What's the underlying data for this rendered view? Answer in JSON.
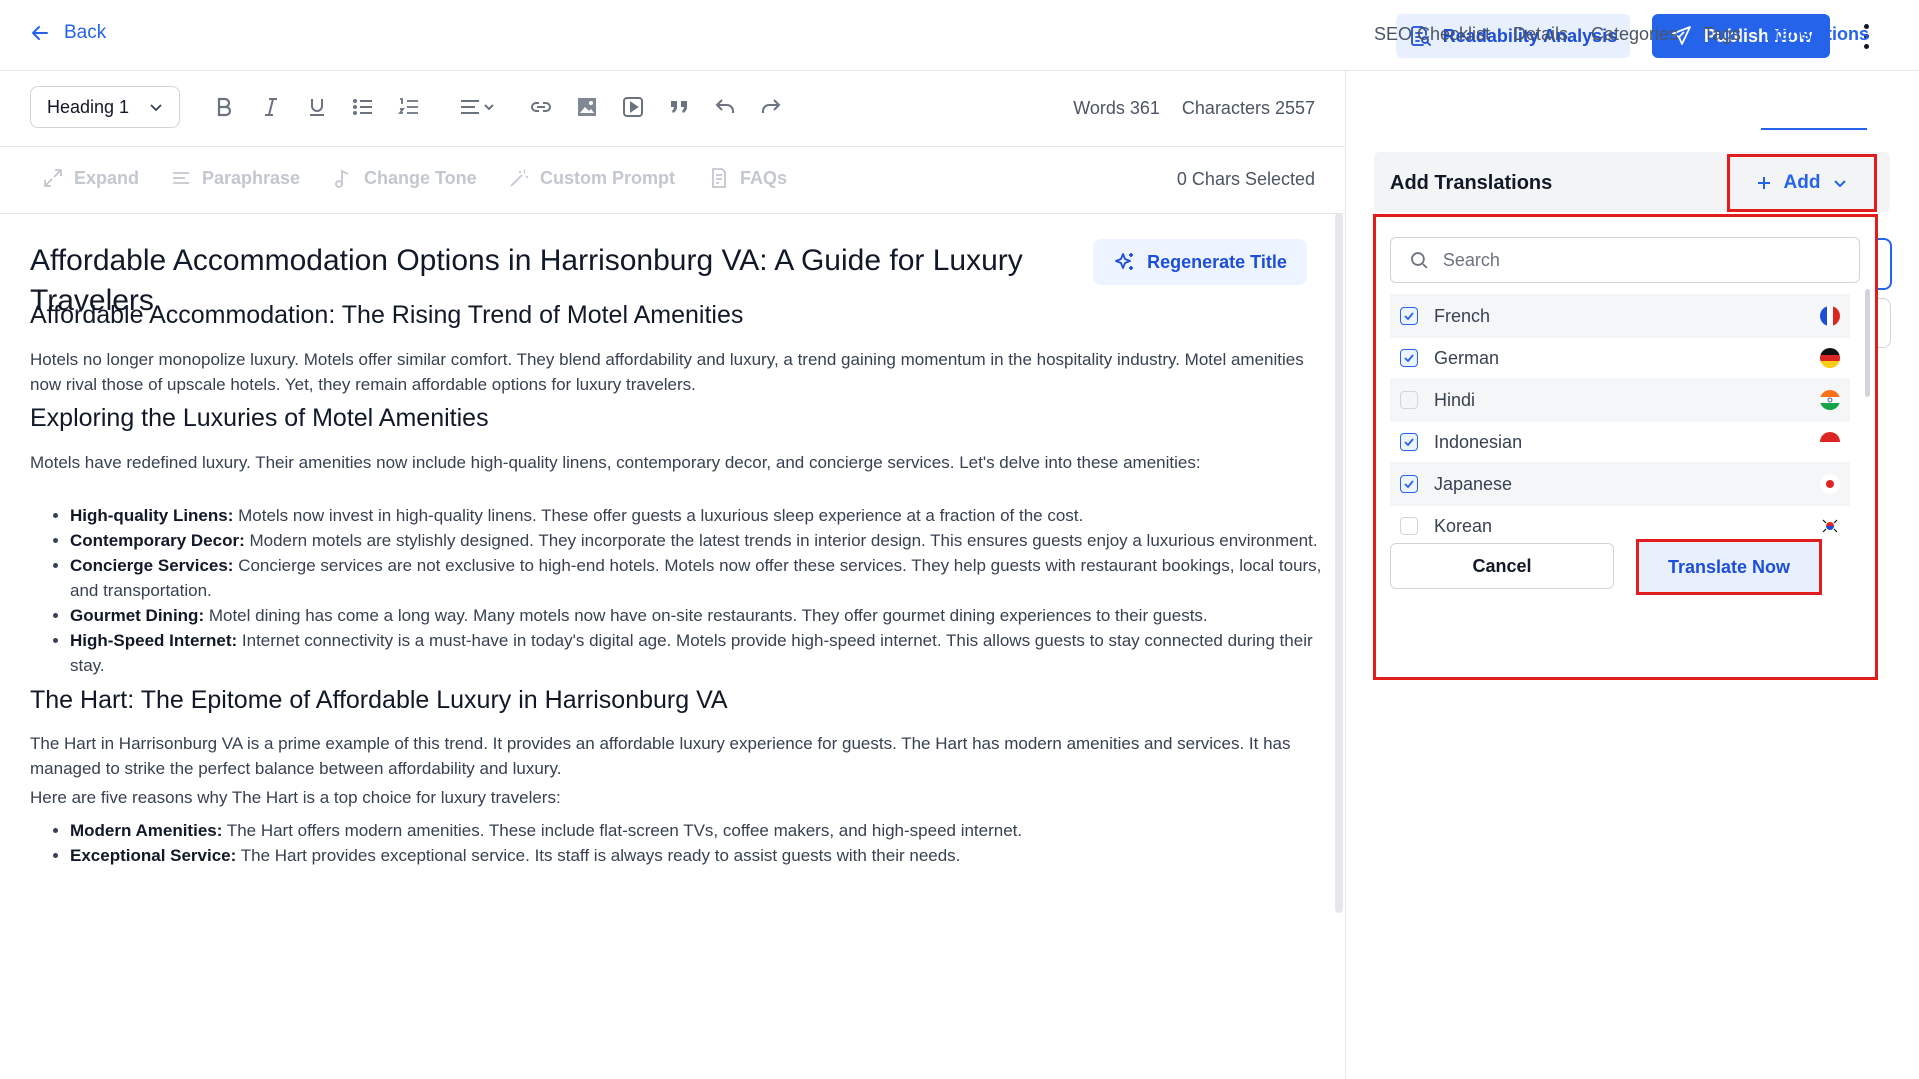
{
  "header": {
    "back_label": "Back",
    "readability_label": "Readability Analysis",
    "publish_label": "Publish Now"
  },
  "toolbar": {
    "heading_value": "Heading 1",
    "words_label": "Words 361",
    "characters_label": "Characters 2557",
    "tools": [
      "bold-icon",
      "italic-icon",
      "underline-icon",
      "bullet-list-icon",
      "numbered-list-icon",
      "align-icon",
      "link-icon",
      "image-icon",
      "video-icon",
      "quote-icon",
      "undo-icon",
      "redo-icon"
    ]
  },
  "ai_tools": {
    "expand": "Expand",
    "paraphrase": "Paraphrase",
    "change_tone": "Change Tone",
    "custom_prompt": "Custom Prompt",
    "faqs": "FAQs",
    "chars_selected": "0 Chars Selected"
  },
  "article": {
    "title": "Affordable Accommodation Options in Harrisonburg VA: A Guide for Luxury Travelers",
    "regenerate_label": "Regenerate Title",
    "h2_1": "Affordable Accommodation: The Rising Trend of Motel Amenities",
    "p1": "Hotels no longer monopolize luxury. Motels offer similar comfort. They blend affordability and luxury, a trend gaining momentum in the hospitality industry. Motel amenities now rival those of upscale hotels. Yet, they remain affordable options for luxury travelers.",
    "h2_2": "Exploring the Luxuries of Motel Amenities",
    "p2": "Motels have redefined luxury. Their amenities now include high-quality linens, contemporary decor, and concierge services. Let's delve into these amenities:",
    "list1": [
      {
        "term": "High-quality Linens:",
        "text": " Motels now invest in high-quality linens. These offer guests a luxurious sleep experience at a fraction of the cost."
      },
      {
        "term": "Contemporary Decor:",
        "text": " Modern motels are stylishly designed. They incorporate the latest trends in interior design. This ensures guests enjoy a luxurious environment."
      },
      {
        "term": "Concierge Services:",
        "text": " Concierge services are not exclusive to high-end hotels. Motels now offer these services. They help guests with restaurant bookings, local tours, and transportation."
      },
      {
        "term": "Gourmet Dining:",
        "text": " Motel dining has come a long way. Many motels now have on-site restaurants. They offer gourmet dining experiences to their guests."
      },
      {
        "term": "High-Speed Internet:",
        "text": " Internet connectivity is a must-have in today's digital age. Motels provide high-speed internet. This allows guests to stay connected during their stay."
      }
    ],
    "h2_3": "The Hart: The Epitome of Affordable Luxury in Harrisonburg VA",
    "p3": "The Hart in Harrisonburg VA is a prime example of this trend. It provides an affordable luxury experience for guests. The Hart has modern amenities and services. It has managed to strike the perfect balance between affordability and luxury.",
    "p4": "Here are five reasons why The Hart is a top choice for luxury travelers:",
    "list2": [
      {
        "term": "Modern Amenities:",
        "text": " The Hart offers modern amenities. These include flat-screen TVs, coffee makers, and high-speed internet."
      },
      {
        "term": "Exceptional Service:",
        "text": " The Hart provides exceptional service. Its staff is always ready to assist guests with their needs."
      }
    ]
  },
  "sidebar": {
    "tabs": [
      "SEO Checklist",
      "Details",
      "Categories",
      "Tags",
      "Translations"
    ],
    "active_tab": "Translations",
    "panel_title": "Add Translations",
    "add_label": "Add",
    "search_placeholder": "Search",
    "languages": [
      {
        "label": "French",
        "checked": true,
        "flag": "flag-france-icon"
      },
      {
        "label": "German",
        "checked": true,
        "flag": "flag-germany-icon"
      },
      {
        "label": "Hindi",
        "checked": false,
        "flag": "flag-india-icon"
      },
      {
        "label": "Indonesian",
        "checked": true,
        "flag": "flag-indonesia-icon"
      },
      {
        "label": "Japanese",
        "checked": true,
        "flag": "flag-japan-icon"
      },
      {
        "label": "Korean",
        "checked": false,
        "flag": "flag-korea-icon"
      }
    ],
    "cancel_label": "Cancel",
    "translate_label": "Translate Now"
  },
  "colors": {
    "accent": "#2563eb",
    "highlight_box": "#e11d1d"
  }
}
